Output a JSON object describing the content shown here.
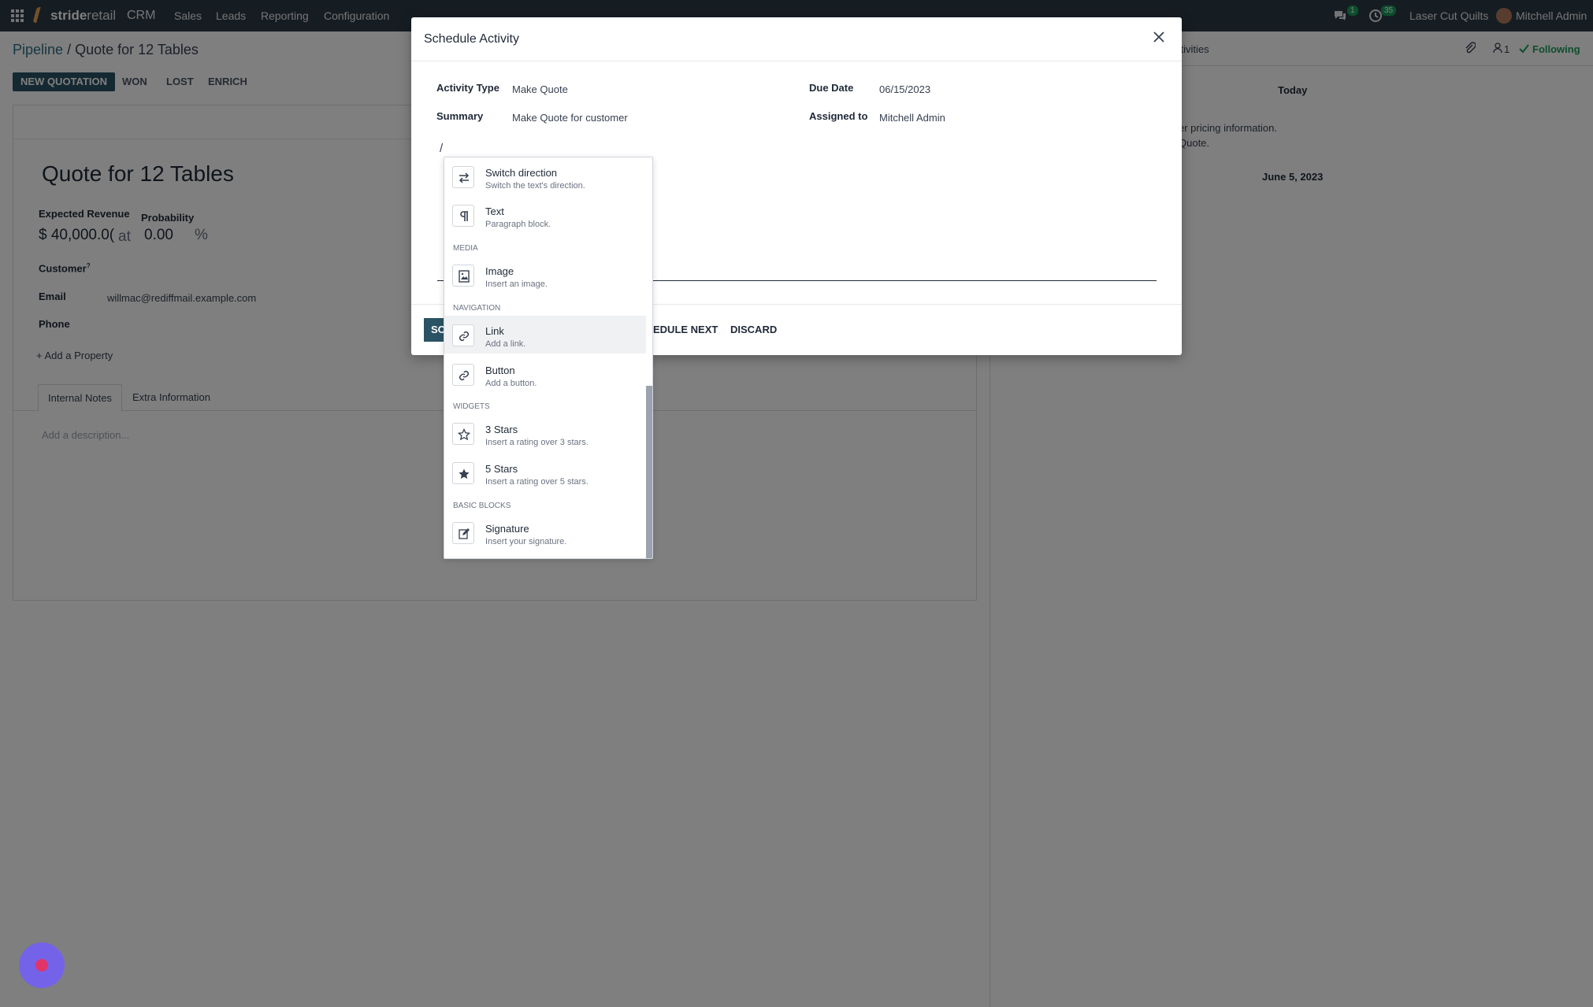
{
  "navbar": {
    "brand": "strideretail",
    "brand_light": "retail",
    "app": "CRM",
    "menus": [
      "Sales",
      "Leads",
      "Reporting",
      "Configuration"
    ],
    "messages_count": "1",
    "activities_count": "35",
    "company": "Laser Cut Quilts",
    "user": "Mitchell Admin"
  },
  "breadcrumb": {
    "parent": "Pipeline",
    "separator": "/",
    "current": "Quote for 12 Tables"
  },
  "actions": {
    "new_quotation": "NEW QUOTATION",
    "won": "WON",
    "lost": "LOST",
    "enrich": "ENRICH"
  },
  "form": {
    "title": "Quote for 12 Tables",
    "expected_revenue_label": "Expected Revenue",
    "expected_revenue": "$ 40,000.0(",
    "at": "at",
    "probability_label": "Probability",
    "probability": "0.00",
    "percent": "%",
    "customer_label": "Customer",
    "customer_help": "?",
    "email_label": "Email",
    "email": "willmac@rediffmail.example.com",
    "phone_label": "Phone",
    "add_property": "Add a Property",
    "tabs": [
      "Internal Notes",
      "Extra Information"
    ],
    "description_placeholder": "Add a description..."
  },
  "chatter": {
    "activities": "ctivities",
    "followers_count": "1",
    "following": "Following",
    "today": "Today",
    "note_line1": "er pricing information.",
    "note_line2": "Quote.",
    "date": "June 5, 2023"
  },
  "modal": {
    "title": "Schedule Activity",
    "activity_type_label": "Activity Type",
    "activity_type": "Make Quote",
    "summary_label": "Summary",
    "summary": "Make Quote for customer",
    "due_date_label": "Due Date",
    "due_date": "06/15/2023",
    "assigned_label": "Assigned to",
    "assigned": "Mitchell Admin",
    "editor_text": "/",
    "btn_schedule": "SC",
    "btn_schedule_next": "EDULE NEXT",
    "btn_discard": "DISCARD"
  },
  "powerbox": {
    "items": [
      {
        "name": "Switch direction",
        "desc": "Switch the text's direction.",
        "icon": "switch-direction-icon"
      },
      {
        "name": "Text",
        "desc": "Paragraph block.",
        "icon": "paragraph-icon"
      },
      {
        "name": "Image",
        "desc": "Insert an image.",
        "icon": "image-icon"
      },
      {
        "name": "Link",
        "desc": "Add a link.",
        "icon": "link-icon"
      },
      {
        "name": "Button",
        "desc": "Add a button.",
        "icon": "link-icon"
      },
      {
        "name": "3 Stars",
        "desc": "Insert a rating over 3 stars.",
        "icon": "star-outline-icon"
      },
      {
        "name": "5 Stars",
        "desc": "Insert a rating over 5 stars.",
        "icon": "star-filled-icon"
      },
      {
        "name": "Signature",
        "desc": "Insert your signature.",
        "icon": "signature-icon"
      }
    ],
    "categories": [
      "MEDIA",
      "NAVIGATION",
      "WIDGETS",
      "BASIC BLOCKS"
    ]
  },
  "colors": {
    "navbar": "#2d3a45",
    "primary": "#2a5364",
    "accent_green": "#1a9c5b",
    "fab": "#7463e8"
  }
}
